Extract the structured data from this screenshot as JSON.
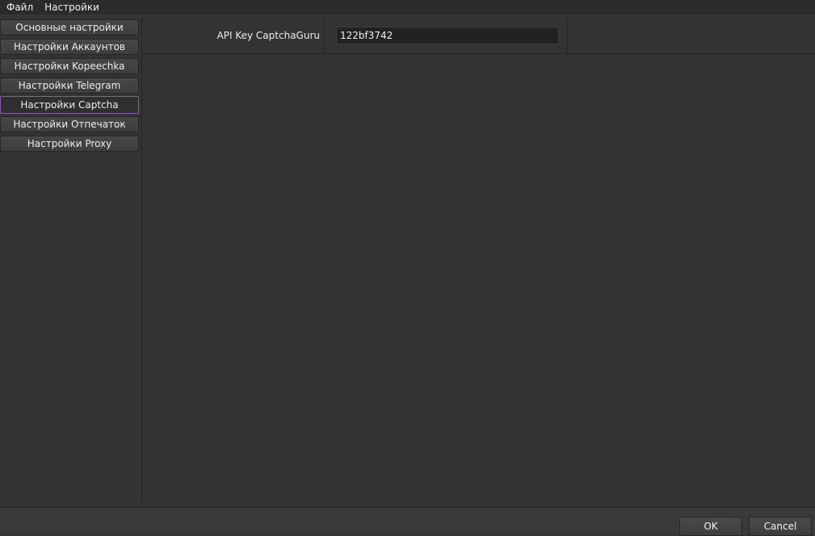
{
  "menubar": {
    "items": [
      {
        "label": "Файл"
      },
      {
        "label": "Настройки"
      }
    ]
  },
  "sidebar": {
    "items": [
      {
        "label": "Основные настройки",
        "active": false
      },
      {
        "label": "Настройки Аккаунтов",
        "active": false
      },
      {
        "label": "Настройки Kopeechka",
        "active": false
      },
      {
        "label": "Настройки Telegram",
        "active": false
      },
      {
        "label": "Настройки Captcha",
        "active": true
      },
      {
        "label": "Настройки Отпечаток",
        "active": false
      },
      {
        "label": "Настройки Proxy",
        "active": false
      }
    ]
  },
  "form": {
    "api_key_label": "API Key CaptchaGuru",
    "api_key_value": "122bf3742"
  },
  "footer": {
    "ok_label": "OK",
    "cancel_label": "Cancel"
  },
  "colors": {
    "active_border": "#8a5aa8",
    "background": "#353535"
  }
}
